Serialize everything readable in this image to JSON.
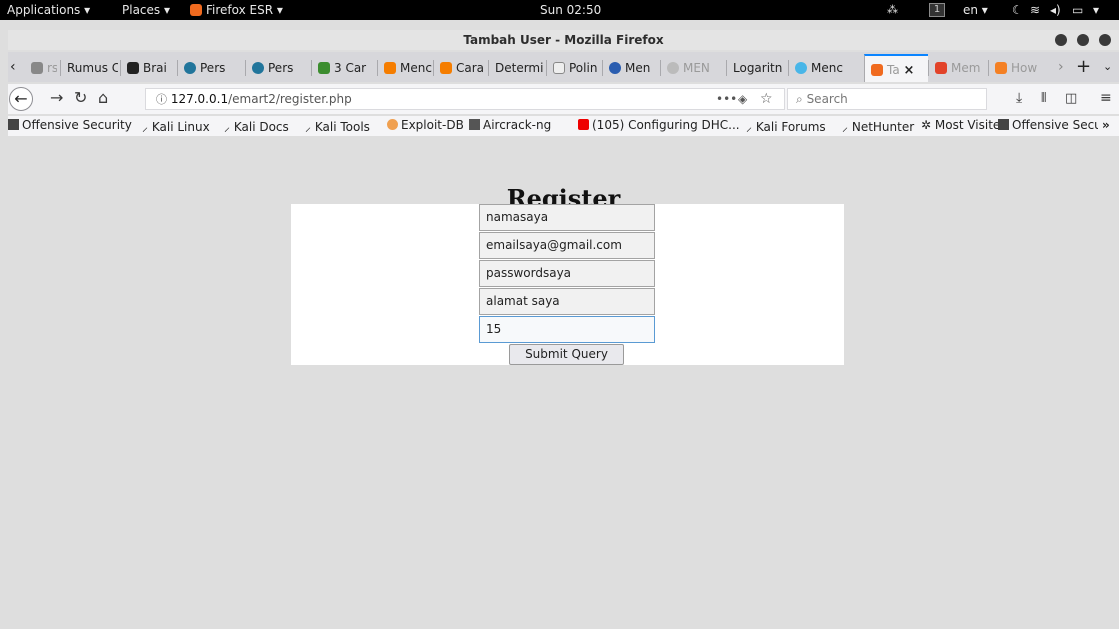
{
  "topbar": {
    "applications": "Applications ▾",
    "places": "Places ▾",
    "app_name": "Firefox ESR ▾",
    "clock": "Sun 02:50",
    "workspace": "1",
    "language": "en ▾"
  },
  "window": {
    "title": "Tambah User - Mozilla Firefox"
  },
  "tabs": [
    {
      "label": "rs",
      "color": "#888888"
    },
    {
      "label": "Rumus C",
      "color": ""
    },
    {
      "label": "Brai",
      "color": "#222222"
    },
    {
      "label": "Pers",
      "color": "#21759b"
    },
    {
      "label": "Pers",
      "color": "#21759b"
    },
    {
      "label": "3 Car",
      "color": "#3c8d2f"
    },
    {
      "label": "Menc",
      "color": "#f57d00"
    },
    {
      "label": "Cara",
      "color": "#f57d00"
    },
    {
      "label": "Determi",
      "color": ""
    },
    {
      "label": "Polin",
      "color": "#444444"
    },
    {
      "label": "Men",
      "color": "#2a5db0"
    },
    {
      "label": "MEN",
      "color": "#bbbbbb"
    },
    {
      "label": "Logaritn",
      "color": ""
    },
    {
      "label": "Menc",
      "color": "#49b6e8"
    },
    {
      "label": "Ta",
      "color": "#f06a1f"
    },
    {
      "label": "Mem",
      "color": "#e24329"
    },
    {
      "label": "How",
      "color": "#f48024"
    }
  ],
  "active_tab_close": "×",
  "nav": {
    "url_host": "127.0.0.1",
    "url_path": "/emart2/register.php",
    "search_placeholder": "Search",
    "page_actions": "•••"
  },
  "bookmarks": [
    {
      "label": "Offensive Security",
      "icon": "offsec-icon"
    },
    {
      "label": "Kali Linux",
      "icon": "kali-icon"
    },
    {
      "label": "Kali Docs",
      "icon": "kali-icon"
    },
    {
      "label": "Kali Tools",
      "icon": "kali-icon"
    },
    {
      "label": "Exploit-DB",
      "icon": "exploitdb-icon"
    },
    {
      "label": "Aircrack-ng",
      "icon": "aircrack-icon"
    },
    {
      "label": "(105) Configuring DHC...",
      "icon": "youtube-icon"
    },
    {
      "label": "Kali Forums",
      "icon": "kali-icon"
    },
    {
      "label": "NetHunter",
      "icon": "kali-icon"
    },
    {
      "label": "Most Visited",
      "icon": "gear-icon"
    },
    {
      "label": "Offensive Security",
      "icon": "offsec-icon"
    }
  ],
  "page": {
    "heading": "Register",
    "fields": [
      {
        "value": "namasaya"
      },
      {
        "value": "emailsaya@gmail.com"
      },
      {
        "value": "passwordsaya"
      },
      {
        "value": "alamat saya"
      },
      {
        "value": "15"
      }
    ],
    "submit_label": "Submit Query"
  },
  "colors": {
    "accent": "#0a84ff",
    "page_bg": "#dedede",
    "focus_border": "#5a9ad3"
  }
}
